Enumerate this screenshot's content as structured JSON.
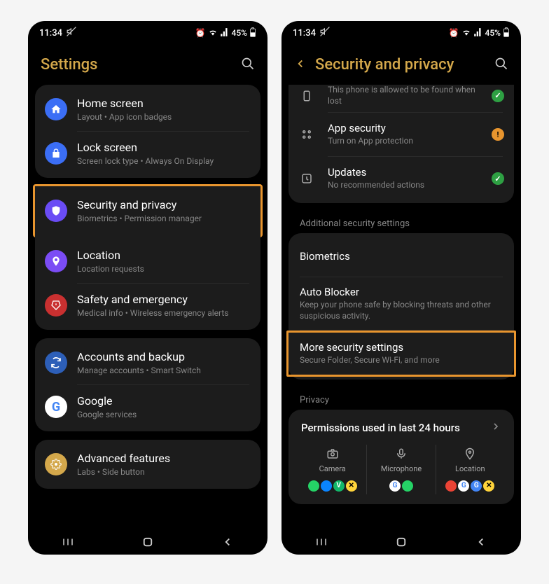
{
  "status": {
    "time": "11:34",
    "battery": "45%"
  },
  "screen1": {
    "title": "Settings",
    "groups": [
      {
        "items": [
          {
            "icon": "home-icon",
            "title": "Home screen",
            "sub": "Layout • App icon badges"
          },
          {
            "icon": "lock-icon",
            "title": "Lock screen",
            "sub": "Screen lock type • Always On Display"
          }
        ]
      },
      {
        "highlight": true,
        "items": [
          {
            "icon": "shield-icon",
            "title": "Security and privacy",
            "sub": "Biometrics • Permission manager"
          }
        ]
      },
      {
        "continuation": true,
        "items": [
          {
            "icon": "location-icon",
            "title": "Location",
            "sub": "Location requests"
          },
          {
            "icon": "emergency-icon",
            "title": "Safety and emergency",
            "sub": "Medical info • Wireless emergency alerts"
          }
        ]
      },
      {
        "items": [
          {
            "icon": "sync-icon",
            "title": "Accounts and backup",
            "sub": "Manage accounts • Smart Switch"
          },
          {
            "icon": "google-icon",
            "title": "Google",
            "sub": "Google services"
          }
        ]
      },
      {
        "items": [
          {
            "icon": "advanced-icon",
            "title": "Advanced features",
            "sub": "Labs • Side button"
          }
        ]
      }
    ]
  },
  "screen2": {
    "title": "Security and privacy",
    "partial_top": {
      "text": "lost",
      "status": "ok"
    },
    "top_items": [
      {
        "icon": "apps-icon",
        "title": "App security",
        "sub": "Turn on App protection",
        "warn": true,
        "status": "warn"
      },
      {
        "icon": "updates-icon",
        "title": "Updates",
        "sub": "No recommended actions",
        "status": "ok"
      }
    ],
    "section1_header": "Additional security settings",
    "section1": [
      {
        "title": "Biometrics"
      },
      {
        "title": "Auto Blocker",
        "sub": "Keep your phone safe by blocking threats and other suspicious activity."
      },
      {
        "title": "More security settings",
        "sub": "Secure Folder, Secure Wi-Fi, and more",
        "highlight": true
      }
    ],
    "section2_header": "Privacy",
    "perms": {
      "title": "Permissions used in last 24 hours",
      "cols": [
        {
          "label": "Camera",
          "apps": [
            {
              "bg": "#25d366",
              "txt": "",
              "c": "#fff"
            },
            {
              "bg": "#0a84ff",
              "txt": "",
              "c": "#fff"
            },
            {
              "bg": "#12b76a",
              "txt": "V",
              "c": "#fff"
            },
            {
              "bg": "#ffd43b",
              "txt": "✕",
              "c": "#000"
            }
          ]
        },
        {
          "label": "Microphone",
          "apps": [
            {
              "bg": "#fff",
              "txt": "G",
              "c": "#4285F4"
            },
            {
              "bg": "#25d366",
              "txt": "",
              "c": "#fff"
            }
          ]
        },
        {
          "label": "Location",
          "apps": [
            {
              "bg": "#ea4335",
              "txt": "",
              "c": "#fff"
            },
            {
              "bg": "#fff",
              "txt": "G",
              "c": "#4285F4"
            },
            {
              "bg": "#4285F4",
              "txt": "G",
              "c": "#fff"
            },
            {
              "bg": "#ffd43b",
              "txt": "✕",
              "c": "#000"
            }
          ]
        }
      ]
    }
  }
}
